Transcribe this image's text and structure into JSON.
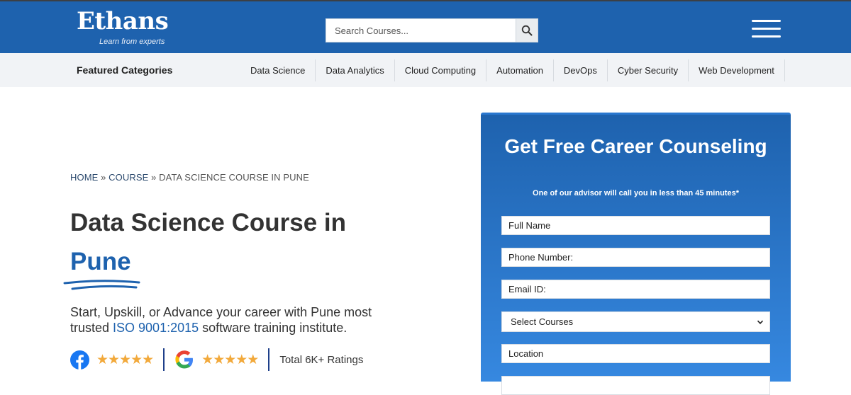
{
  "header": {
    "logo_word": "Ethans",
    "logo_tagline": "Learn from experts",
    "search_placeholder": "Search Courses...",
    "search_icon": "search-icon",
    "menu_icon": "hamburger-menu-icon"
  },
  "categories": {
    "title": "Featured Categories",
    "items": [
      "Data Science",
      "Data Analytics",
      "Cloud Computing",
      "Automation",
      "DevOps",
      "Cyber Security",
      "Web Development"
    ]
  },
  "breadcrumb": {
    "home": "HOME",
    "sep1": " » ",
    "course": "COURSE",
    "sep2": " » ",
    "current": "DATA SCIENCE COURSE IN PUNE"
  },
  "hero": {
    "title_line1": "Data Science Course in",
    "title_city": "Pune",
    "lead_part1": "Start, Upskill, or Advance your career with Pune most trusted ",
    "lead_iso": "ISO 9001:2015",
    "lead_part2": " software training institute.",
    "facebook_icon": "facebook-icon",
    "google_icon": "google-icon",
    "facebook_stars": "★★★★★",
    "google_stars": "★★★★★",
    "total_ratings": "Total 6K+ Ratings"
  },
  "form": {
    "title": "Get Free Career Counseling",
    "subtitle": "One of our advisor will call you in less than 45 minutes*",
    "full_name": "Full Name",
    "phone": "Phone Number:",
    "email": "Email ID:",
    "select_courses": "Select Courses",
    "location": "Location"
  },
  "colors": {
    "brand_blue": "#1e62ae",
    "star": "#f2a93b"
  }
}
